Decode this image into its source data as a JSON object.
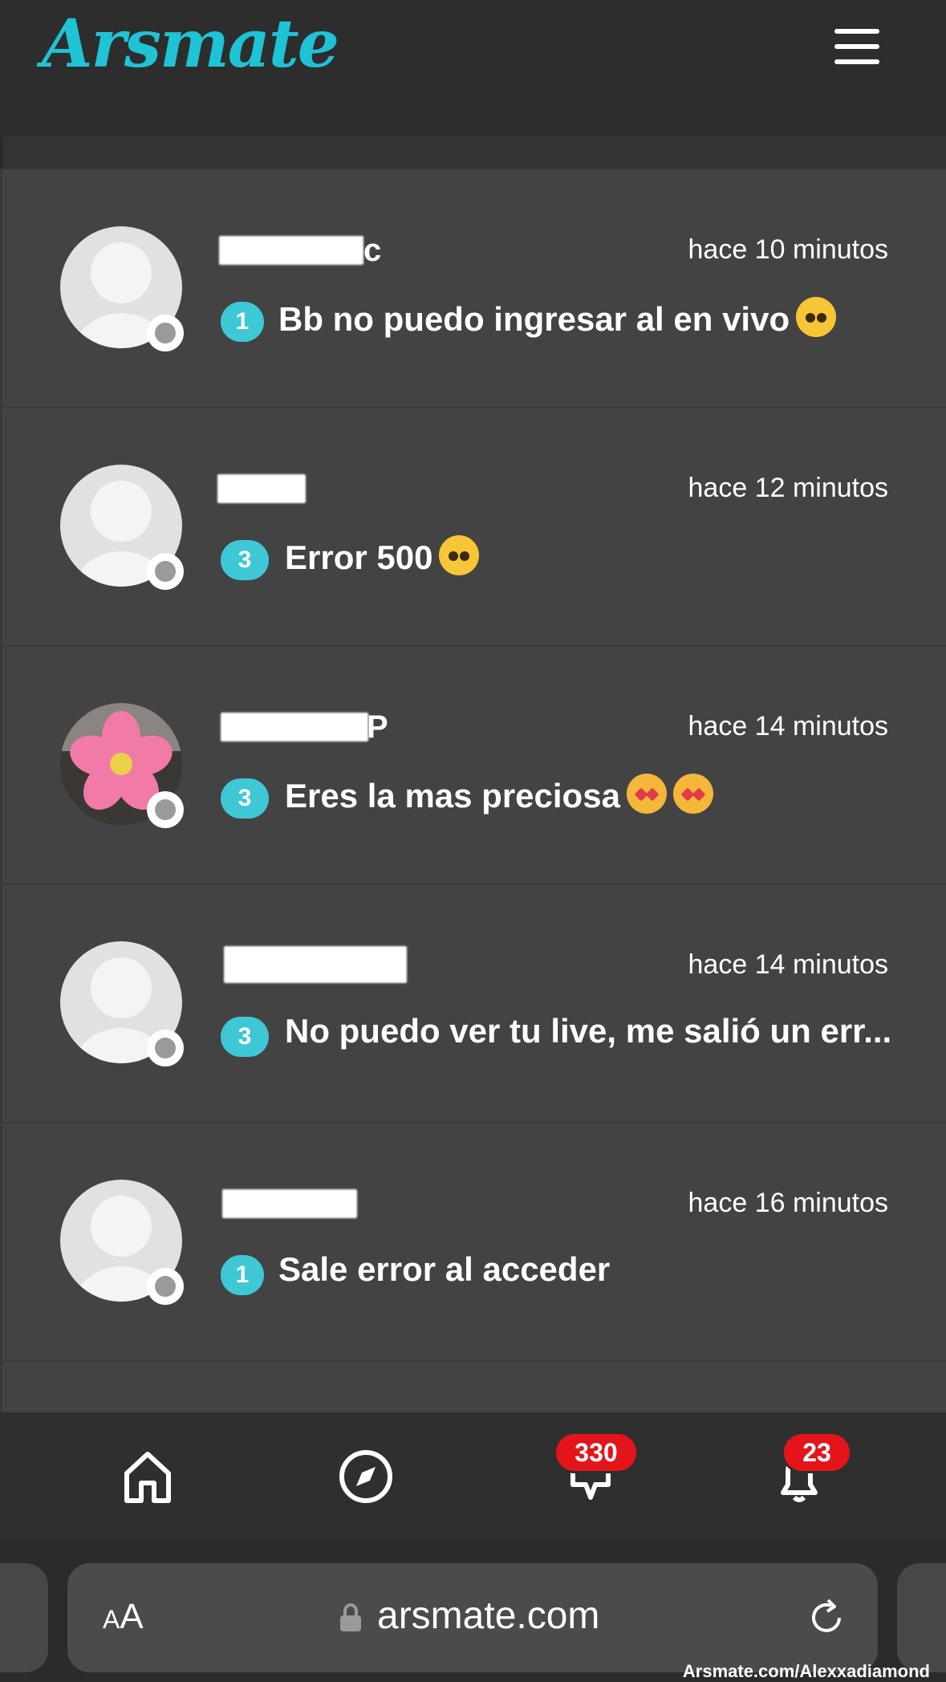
{
  "app": {
    "logo_text": "Arsmate",
    "brand_color": "#1ec3d6"
  },
  "header": {
    "menu_icon": "hamburger-menu-icon"
  },
  "conversations": [
    {
      "name_visible": "c",
      "time": "hace 10 minutos",
      "unread": "1",
      "preview": "Bb no puedo ingresar al en vivo",
      "avatar": "default",
      "emoji": "pleading-face"
    },
    {
      "name_visible": "",
      "time": "hace 12 minutos",
      "unread": "3",
      "preview": "Error 500",
      "avatar": "default",
      "emoji": "pleading-face"
    },
    {
      "name_visible": "P",
      "time": "hace 14 minutos",
      "unread": "3",
      "preview": "Eres la mas preciosa",
      "avatar": "flower-photo",
      "emoji": "smiling-face-with-hearts"
    },
    {
      "name_visible": "",
      "time": "hace 14 minutos",
      "unread": "3",
      "preview": "No puedo ver tu live, me salió un err...",
      "avatar": "default",
      "emoji": ""
    },
    {
      "name_visible": "",
      "time": "hace 16 minutos",
      "unread": "1",
      "preview": "Sale error al acceder",
      "avatar": "default",
      "emoji": ""
    }
  ],
  "bottom_nav": {
    "home_icon": "home-icon",
    "explore_icon": "compass-icon",
    "messages_icon": "message-icon",
    "messages_count": "330",
    "notifications_icon": "bell-icon",
    "notifications_count": "23",
    "badge_color": "#e4141b"
  },
  "browser": {
    "text_size_label_small": "A",
    "text_size_label_large": "A",
    "url": "arsmate.com",
    "lock_icon": "lock-icon",
    "reload_icon": "reload-icon",
    "watermark": "Arsmate.com/Alexxadiamond"
  }
}
